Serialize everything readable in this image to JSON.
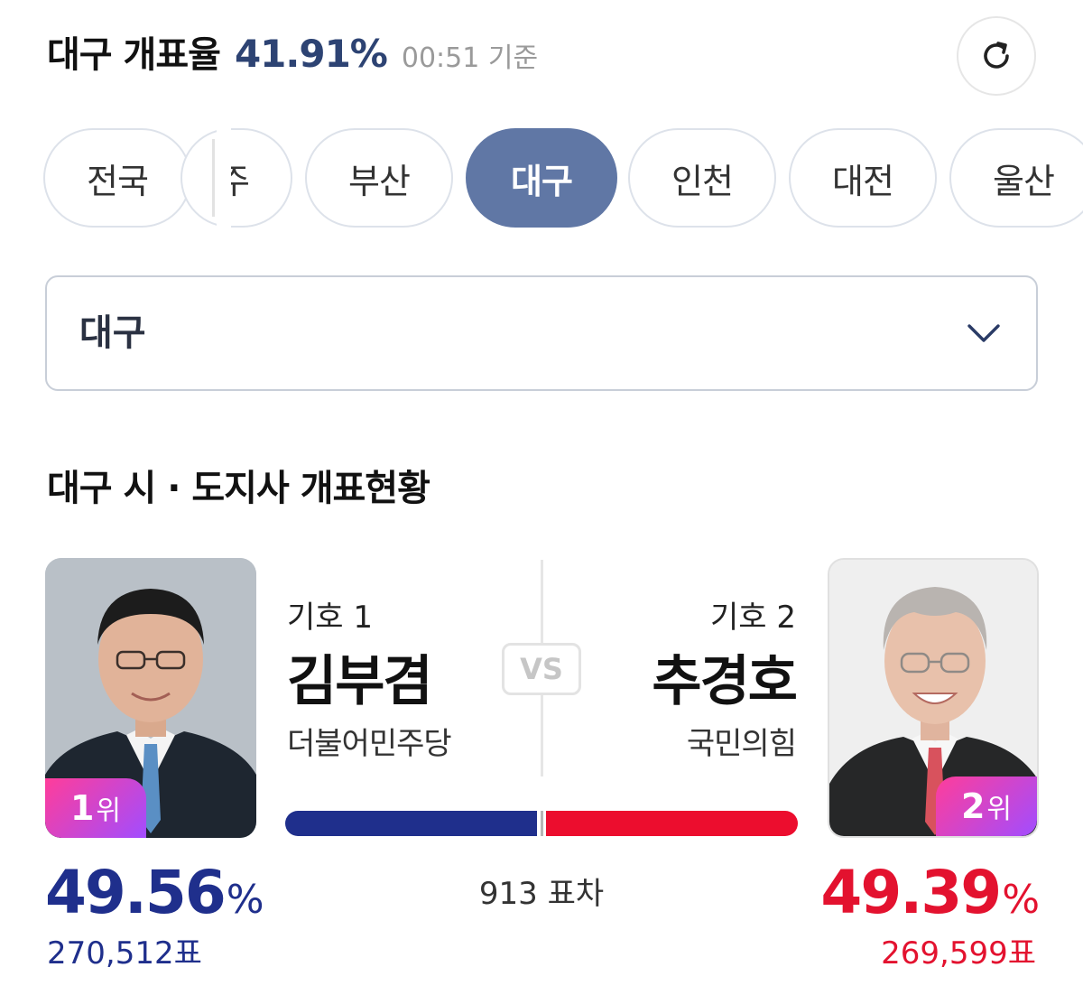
{
  "header": {
    "title": "대구 개표율",
    "rate": "41.91%",
    "time": "00:51 기준",
    "refresh_icon": "refresh-icon"
  },
  "tabs": [
    {
      "label": "전국",
      "active": false
    },
    {
      "label": "주",
      "active": false
    },
    {
      "label": "부산",
      "active": false
    },
    {
      "label": "대구",
      "active": true
    },
    {
      "label": "인천",
      "active": false
    },
    {
      "label": "대전",
      "active": false
    },
    {
      "label": "울산",
      "active": false
    }
  ],
  "region_select": {
    "value": "대구",
    "icon": "chevron-down-icon"
  },
  "section_title": "대구 시 · 도지사 개표현황",
  "candidates": [
    {
      "number": "기호 1",
      "name": "김부겸",
      "party": "더불어민주당",
      "rank_num": "1",
      "rank_suffix": "위",
      "pct_value": "49.56",
      "pct_unit": "%",
      "votes": "270,512표",
      "color": "#1f2f8c"
    },
    {
      "number": "기호 2",
      "name": "추경호",
      "party": "국민의힘",
      "rank_num": "2",
      "rank_suffix": "위",
      "pct_value": "49.39",
      "pct_unit": "%",
      "votes": "269,599표",
      "color": "#e3122f"
    }
  ],
  "vs_label": "VS",
  "vote_gap": "913 표차",
  "bar": {
    "left_pct": 49.56,
    "right_pct": 49.39
  }
}
